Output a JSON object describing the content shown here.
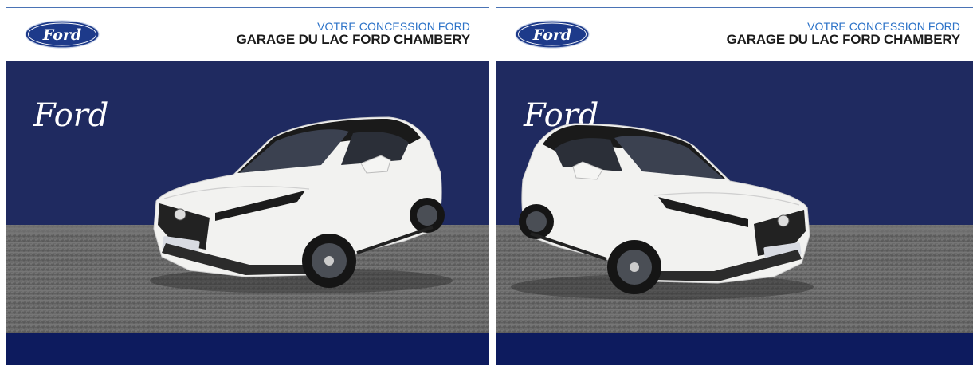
{
  "brand": "Ford",
  "panels": [
    {
      "dealer": {
        "line1": "VOTRE CONCESSION FORD",
        "line2": "GARAGE DU LAC FORD CHAMBERY"
      },
      "car_view": "front-left three-quarter"
    },
    {
      "dealer": {
        "line1": "VOTRE CONCESSION FORD",
        "line2": "GARAGE DU LAC FORD CHAMBERY"
      },
      "car_view": "front-right three-quarter"
    }
  ],
  "colors": {
    "ford_blue": "#1d3a8a",
    "backdrop_navy": "#1f2a60",
    "footer_navy": "#0d1b5e",
    "accent_blue": "#2d73c8",
    "car_white": "#f2f2f0"
  },
  "icons": [
    "ford-oval-logo",
    "ford-script-logo"
  ]
}
